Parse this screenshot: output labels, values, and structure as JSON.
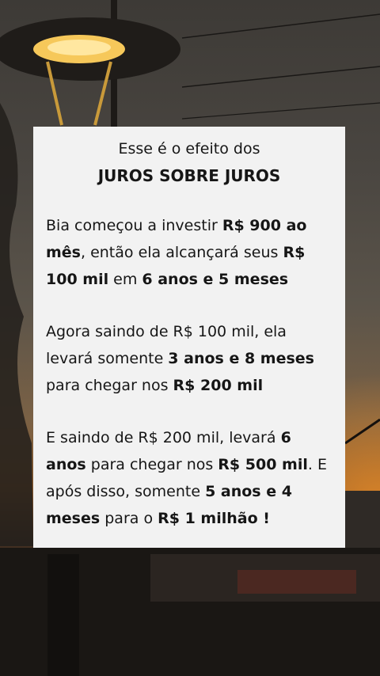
{
  "card": {
    "title_line1": "Esse é o efeito dos",
    "title_line2": "JUROS SOBRE JUROS",
    "p1": {
      "t1": "Bia começou a investir ",
      "b1": "R$ 900 ao mês",
      "t2": ", então ela alcançará seus ",
      "b2": "R$ 100 mil",
      "t3": " em ",
      "b3": "6 anos e 5 meses"
    },
    "p2": {
      "t1": "Agora saindo de R$ 100 mil, ela levará somente ",
      "b1": "3 anos e 8 meses",
      "t2": " para chegar nos ",
      "b2": "R$ 200 mil"
    },
    "p3": {
      "t1": "E saindo de R$ 200 mil, levará ",
      "b1": "6 anos",
      "t2": " para chegar nos ",
      "b2": "R$ 500 mil",
      "t3": ". E após disso, somente ",
      "b3": "5 anos e 4 meses",
      "t4": " para o ",
      "b4": "R$ 1 milhão !"
    }
  },
  "colors": {
    "card_bg": "#f2f2f2",
    "text": "#161616",
    "sky_orange": "#e88c28"
  }
}
